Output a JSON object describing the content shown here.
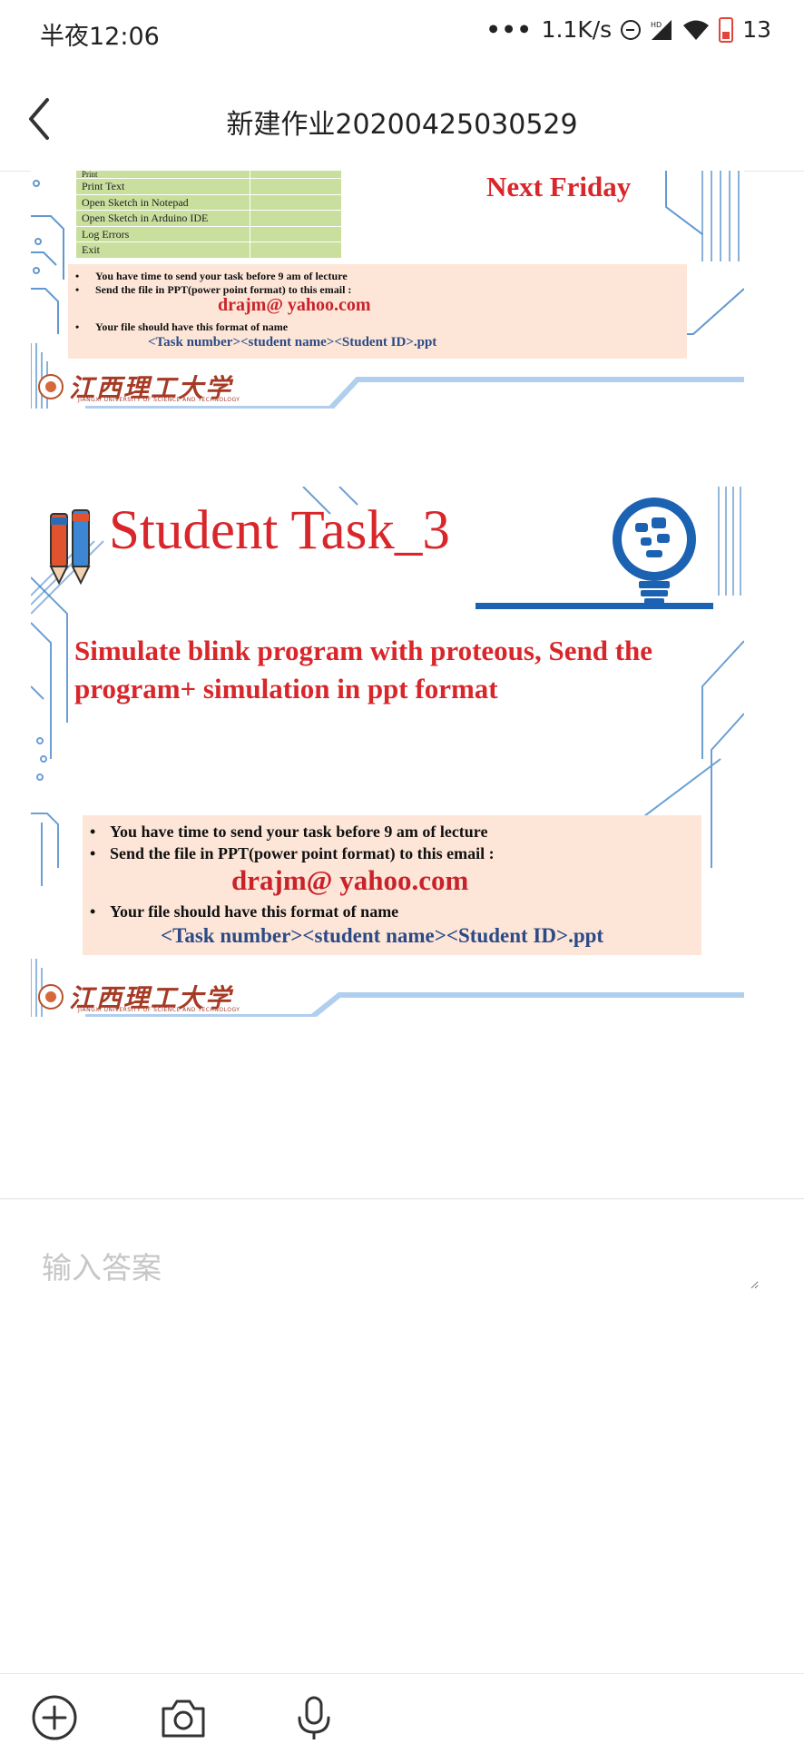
{
  "status_bar": {
    "time": "半夜12:06",
    "network_speed": "1.1K/s",
    "network_type": "HD",
    "battery_level": "13",
    "icons": [
      "dnd-icon",
      "signal-icon",
      "wifi-icon",
      "battery-icon"
    ]
  },
  "header": {
    "title": "新建作业20200425030529",
    "back_icon": "chevron-left-icon"
  },
  "slide1": {
    "menu_items": [
      "Print",
      "Print Text",
      "Open Sketch in Notepad",
      "Open Sketch in Arduino IDE",
      "Log Errors",
      "Exit"
    ],
    "deadline": "Next Friday",
    "notes": {
      "line1": "You have time to send your task before 9 am of lecture",
      "line2": "Send the file in PPT(power point format) to this email :",
      "email": "drajm@ yahoo.com",
      "line3": "Your file should have this format of name",
      "format": "<Task number><student name><Student ID>.ppt"
    },
    "logo_text": "江西理工大学",
    "logo_sub": "JIANGXI UNIVERSITY OF SCIENCE AND TECHNOLOGY"
  },
  "slide2": {
    "title": "Student Task_3",
    "description": "Simulate blink program with proteous, Send the program+ simulation in ppt format",
    "notes": {
      "line1": "You have time to send your task before 9 am of lecture",
      "line2": "Send the file in PPT(power point format) to this email :",
      "email": "drajm@ yahoo.com",
      "line3": "Your file should have this format of name",
      "format": "<Task number><student name><Student ID>.ppt"
    },
    "logo_text": "江西理工大学",
    "logo_sub": "JIANGXI UNIVERSITY OF SCIENCE AND TECHNOLOGY"
  },
  "answer": {
    "placeholder": "输入答案",
    "value": ""
  },
  "toolbar": {
    "icons": [
      "add-circle-icon",
      "camera-icon",
      "microphone-icon"
    ]
  },
  "colors": {
    "slide_red": "#d8262a",
    "note_bg": "#fde6d8",
    "format_blue": "#2b4a86",
    "circuit_blue": "#3b7fc4",
    "table_green": "#c9df9e"
  }
}
